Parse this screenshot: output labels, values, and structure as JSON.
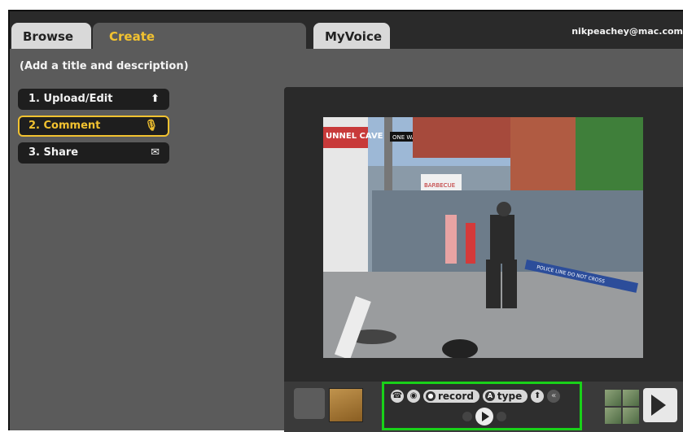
{
  "tabs": {
    "browse": "Browse",
    "create": "Create",
    "myvoice": "MyVoice"
  },
  "user": {
    "email": "nikpeachey@mac.com"
  },
  "description_prompt": "(Add a title and description)",
  "steps": [
    {
      "label": "1. Upload/Edit",
      "icon": "upload-icon"
    },
    {
      "label": "2. Comment",
      "icon": "microphone-icon"
    },
    {
      "label": "3. Share",
      "icon": "envelope-icon"
    }
  ],
  "comment_controls": {
    "record_label": "record",
    "type_label": "type",
    "icons": [
      "phone-icon",
      "webcam-icon",
      "microphone-icon",
      "text-icon",
      "upload-icon",
      "rewind-icon",
      "play-icon"
    ]
  },
  "photo_signs": {
    "sign_top_left": "UNNEL CAVE ZONE",
    "street_sign": "ONE WAY",
    "store_sign": "BARBECUE",
    "barrier": "POLICE LINE DO NOT CROSS"
  },
  "colors": {
    "accent": "#f2c230",
    "highlight": "#19d119",
    "panel": "#5b5b5b"
  }
}
